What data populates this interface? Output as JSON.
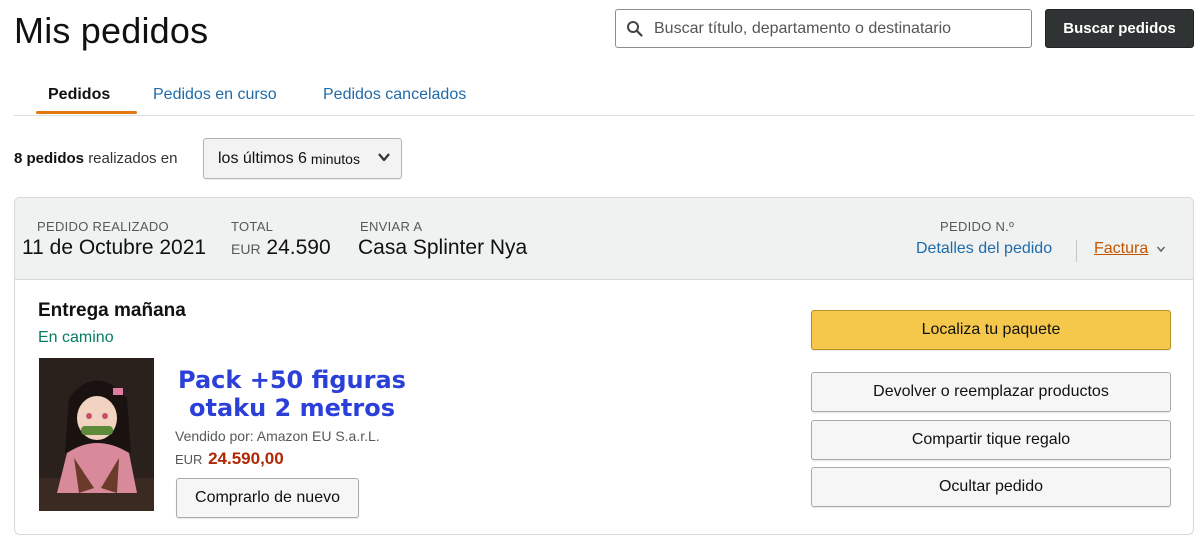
{
  "header": {
    "title": "Mis pedidos",
    "search_placeholder": "Buscar título, departamento o destinatario",
    "search_button": "Buscar pedidos"
  },
  "tabs": [
    {
      "label": "Pedidos",
      "active": true
    },
    {
      "label": "Pedidos en curso",
      "active": false
    },
    {
      "label": "Pedidos cancelados",
      "active": false
    }
  ],
  "filter": {
    "count": "8 pedidos",
    "text": "realizados en",
    "selected": "los últimos 6",
    "selected_unit": "minutos"
  },
  "order": {
    "placed_label": "PEDIDO REALIZADO",
    "placed_value": "11 de Octubre 2021",
    "total_label": "TOTAL",
    "total_currency": "EUR",
    "total_value": "24.590",
    "ship_label": "ENVIAR A",
    "ship_value": "Casa Splinter Nya",
    "number_label": "PEDIDO N.º",
    "details_link": "Detalles del pedido",
    "invoice_link": "Factura",
    "delivery_title": "Entrega mañana",
    "status": "En camino",
    "product": {
      "title_line1": "Pack +50 figuras",
      "title_line2": "otaku 2 metros",
      "seller": "Vendido por: Amazon EU S.a.r.L.",
      "price_currency": "EUR",
      "price_value": "24.590,00",
      "buy_again": "Comprarlo de nuevo"
    },
    "actions": {
      "track": "Localiza tu paquete",
      "return": "Devolver o reemplazar productos",
      "gift": "Compartir tique regalo",
      "hide": "Ocultar pedido"
    }
  },
  "colors": {
    "link": "#1f6aa8",
    "tab_underline": "#e47911",
    "track_button": "#f5c84c",
    "status_green": "#067d62",
    "price_red": "#b12704",
    "product_title": "#2b3fd9",
    "search_button_bg": "#303333"
  },
  "icons": {
    "search": "search-icon",
    "select": "chevron-down-icon",
    "invoice": "chevron-down-icon"
  }
}
